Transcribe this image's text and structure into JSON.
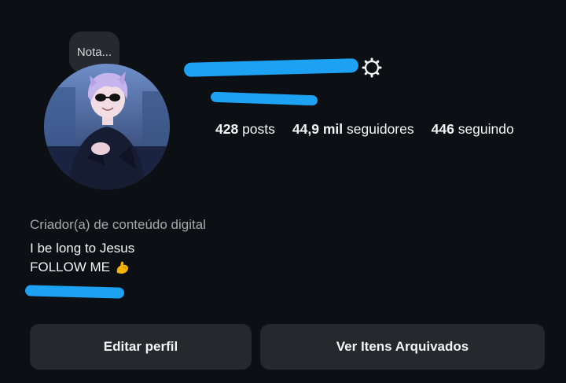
{
  "note": {
    "text": "Nota..."
  },
  "profile": {
    "username": "",
    "stats": {
      "posts_count": "428",
      "posts_label": "posts",
      "followers_count": "44,9 mil",
      "followers_label": "seguidores",
      "following_count": "446",
      "following_label": "seguindo"
    },
    "category": "Criador(a) de conteúdo digital",
    "bio": {
      "line1": "I be long to Jesus",
      "line2": "FOLLOW ME"
    }
  },
  "buttons": {
    "edit_label": "Editar perfil",
    "archive_label": "Ver Itens Arquivados"
  },
  "icons": {
    "settings": "gear-icon",
    "emoji": "flexed-biceps-icon"
  },
  "colors": {
    "background": "#0c1014",
    "button_bg": "#25292e",
    "redaction": "#1da1f2",
    "secondary_text": "#a8a8a8"
  }
}
